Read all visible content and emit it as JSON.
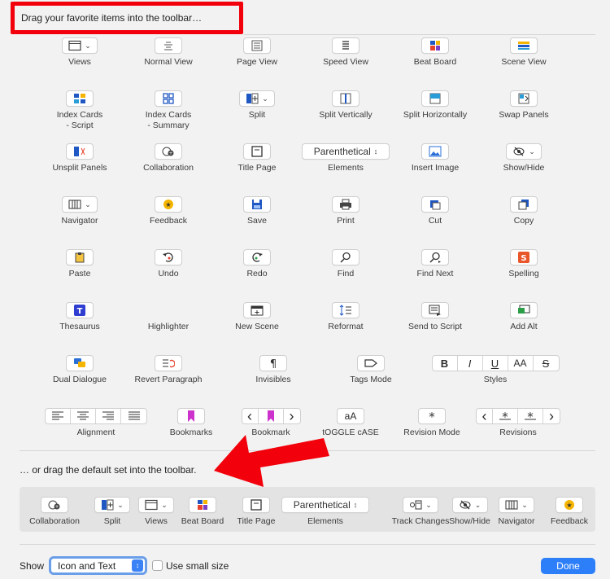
{
  "header": {
    "instruction": "Drag your favorite items into the toolbar…"
  },
  "items": [
    {
      "label": "Views",
      "icon": "views-icon"
    },
    {
      "label": "Normal View",
      "icon": "normal-view-icon"
    },
    {
      "label": "Page View",
      "icon": "page-view-icon"
    },
    {
      "label": "Speed View",
      "icon": "speed-view-icon"
    },
    {
      "label": "Beat Board",
      "icon": "beat-board-icon"
    },
    {
      "label": "Scene View",
      "icon": "scene-view-icon"
    },
    {
      "label": "Index Cards - Script",
      "icon": "index-cards-script-icon"
    },
    {
      "label": "Index Cards - Summary",
      "icon": "index-cards-summary-icon"
    },
    {
      "label": "Split",
      "icon": "split-icon"
    },
    {
      "label": "Split Vertically",
      "icon": "split-vertically-icon"
    },
    {
      "label": "Split Horizontally",
      "icon": "split-horizontally-icon"
    },
    {
      "label": "Swap Panels",
      "icon": "swap-panels-icon"
    },
    {
      "label": "Unsplit Panels",
      "icon": "unsplit-panels-icon"
    },
    {
      "label": "Collaboration",
      "icon": "collaboration-icon"
    },
    {
      "label": "Title Page",
      "icon": "title-page-icon"
    },
    {
      "label": "Elements",
      "icon": "elements-popup",
      "popup": "Parenthetical"
    },
    {
      "label": "Insert Image",
      "icon": "insert-image-icon"
    },
    {
      "label": "Show/Hide",
      "icon": "show-hide-icon"
    },
    {
      "label": "Navigator",
      "icon": "navigator-icon"
    },
    {
      "label": "Feedback",
      "icon": "feedback-icon"
    },
    {
      "label": "Save",
      "icon": "save-icon"
    },
    {
      "label": "Print",
      "icon": "print-icon"
    },
    {
      "label": "Cut",
      "icon": "cut-icon"
    },
    {
      "label": "Copy",
      "icon": "copy-icon"
    },
    {
      "label": "Paste",
      "icon": "paste-icon"
    },
    {
      "label": "Undo",
      "icon": "undo-icon"
    },
    {
      "label": "Redo",
      "icon": "redo-icon"
    },
    {
      "label": "Find",
      "icon": "find-icon"
    },
    {
      "label": "Find Next",
      "icon": "find-next-icon"
    },
    {
      "label": "Spelling",
      "icon": "spelling-icon"
    },
    {
      "label": "Thesaurus",
      "icon": "thesaurus-icon"
    },
    {
      "label": "Highlighter",
      "icon": "highlighter-icon"
    },
    {
      "label": "New Scene",
      "icon": "new-scene-icon"
    },
    {
      "label": "Reformat",
      "icon": "reformat-icon"
    },
    {
      "label": "Send to Script",
      "icon": "send-to-script-icon"
    },
    {
      "label": "Add Alt",
      "icon": "add-alt-icon"
    },
    {
      "label": "Dual Dialogue",
      "icon": "dual-dialogue-icon"
    },
    {
      "label": "Revert Paragraph",
      "icon": "revert-paragraph-icon"
    },
    {
      "label": "Invisibles",
      "icon": "invisibles-icon"
    },
    {
      "label": "Tags Mode",
      "icon": "tags-mode-icon"
    },
    {
      "label": "Styles",
      "icon": "styles-segmented",
      "segments": [
        "B",
        "I",
        "U",
        "AA",
        "S"
      ]
    },
    {
      "label": "Alignment",
      "icon": "alignment-segmented"
    },
    {
      "label": "Bookmarks",
      "icon": "bookmarks-icon"
    },
    {
      "label": "Bookmark",
      "icon": "bookmark-nav"
    },
    {
      "label": "tOGGLE cASE",
      "icon": "toggle-case-icon",
      "glyph": "aA"
    },
    {
      "label": "Revision Mode",
      "icon": "revision-mode-icon"
    },
    {
      "label": "Revisions",
      "icon": "revisions-nav"
    }
  ],
  "default_set": {
    "caption": "… or drag the default set into the toolbar.",
    "items": [
      {
        "label": "Collaboration",
        "icon": "collaboration-icon"
      },
      {
        "label": "Split",
        "icon": "split-icon"
      },
      {
        "label": "Views",
        "icon": "views-icon"
      },
      {
        "label": "Beat Board",
        "icon": "beat-board-icon"
      },
      {
        "label": "Title Page",
        "icon": "title-page-icon"
      },
      {
        "label": "Elements",
        "icon": "elements-popup",
        "popup": "Parenthetical"
      },
      {
        "label": "Track Changes",
        "icon": "track-changes-icon"
      },
      {
        "label": "Show/Hide",
        "icon": "show-hide-icon"
      },
      {
        "label": "Navigator",
        "icon": "navigator-icon"
      },
      {
        "label": "Feedback",
        "icon": "feedback-icon"
      }
    ]
  },
  "footer": {
    "show_label": "Show",
    "show_value": "Icon and Text",
    "small_size_label": "Use small size",
    "small_size_checked": false,
    "done_label": "Done"
  },
  "colors": {
    "accent": "#2d7ff9",
    "highlight_box": "#f2000b",
    "annotation_arrow": "#f2000b"
  }
}
